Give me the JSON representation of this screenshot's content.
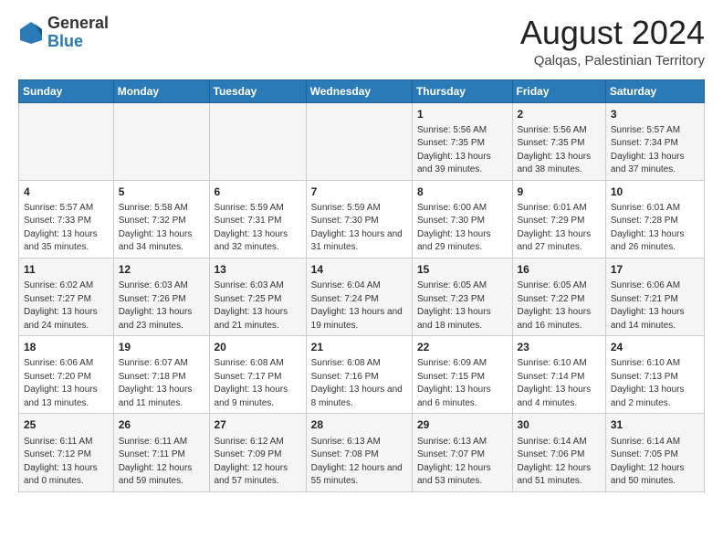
{
  "logo": {
    "general": "General",
    "blue": "Blue"
  },
  "header": {
    "month_year": "August 2024",
    "location": "Qalqas, Palestinian Territory"
  },
  "weekdays": [
    "Sunday",
    "Monday",
    "Tuesday",
    "Wednesday",
    "Thursday",
    "Friday",
    "Saturday"
  ],
  "weeks": [
    [
      {
        "day": "",
        "info": ""
      },
      {
        "day": "",
        "info": ""
      },
      {
        "day": "",
        "info": ""
      },
      {
        "day": "",
        "info": ""
      },
      {
        "day": "1",
        "info": "Sunrise: 5:56 AM\nSunset: 7:35 PM\nDaylight: 13 hours and 39 minutes."
      },
      {
        "day": "2",
        "info": "Sunrise: 5:56 AM\nSunset: 7:35 PM\nDaylight: 13 hours and 38 minutes."
      },
      {
        "day": "3",
        "info": "Sunrise: 5:57 AM\nSunset: 7:34 PM\nDaylight: 13 hours and 37 minutes."
      }
    ],
    [
      {
        "day": "4",
        "info": "Sunrise: 5:57 AM\nSunset: 7:33 PM\nDaylight: 13 hours and 35 minutes."
      },
      {
        "day": "5",
        "info": "Sunrise: 5:58 AM\nSunset: 7:32 PM\nDaylight: 13 hours and 34 minutes."
      },
      {
        "day": "6",
        "info": "Sunrise: 5:59 AM\nSunset: 7:31 PM\nDaylight: 13 hours and 32 minutes."
      },
      {
        "day": "7",
        "info": "Sunrise: 5:59 AM\nSunset: 7:30 PM\nDaylight: 13 hours and 31 minutes."
      },
      {
        "day": "8",
        "info": "Sunrise: 6:00 AM\nSunset: 7:30 PM\nDaylight: 13 hours and 29 minutes."
      },
      {
        "day": "9",
        "info": "Sunrise: 6:01 AM\nSunset: 7:29 PM\nDaylight: 13 hours and 27 minutes."
      },
      {
        "day": "10",
        "info": "Sunrise: 6:01 AM\nSunset: 7:28 PM\nDaylight: 13 hours and 26 minutes."
      }
    ],
    [
      {
        "day": "11",
        "info": "Sunrise: 6:02 AM\nSunset: 7:27 PM\nDaylight: 13 hours and 24 minutes."
      },
      {
        "day": "12",
        "info": "Sunrise: 6:03 AM\nSunset: 7:26 PM\nDaylight: 13 hours and 23 minutes."
      },
      {
        "day": "13",
        "info": "Sunrise: 6:03 AM\nSunset: 7:25 PM\nDaylight: 13 hours and 21 minutes."
      },
      {
        "day": "14",
        "info": "Sunrise: 6:04 AM\nSunset: 7:24 PM\nDaylight: 13 hours and 19 minutes."
      },
      {
        "day": "15",
        "info": "Sunrise: 6:05 AM\nSunset: 7:23 PM\nDaylight: 13 hours and 18 minutes."
      },
      {
        "day": "16",
        "info": "Sunrise: 6:05 AM\nSunset: 7:22 PM\nDaylight: 13 hours and 16 minutes."
      },
      {
        "day": "17",
        "info": "Sunrise: 6:06 AM\nSunset: 7:21 PM\nDaylight: 13 hours and 14 minutes."
      }
    ],
    [
      {
        "day": "18",
        "info": "Sunrise: 6:06 AM\nSunset: 7:20 PM\nDaylight: 13 hours and 13 minutes."
      },
      {
        "day": "19",
        "info": "Sunrise: 6:07 AM\nSunset: 7:18 PM\nDaylight: 13 hours and 11 minutes."
      },
      {
        "day": "20",
        "info": "Sunrise: 6:08 AM\nSunset: 7:17 PM\nDaylight: 13 hours and 9 minutes."
      },
      {
        "day": "21",
        "info": "Sunrise: 6:08 AM\nSunset: 7:16 PM\nDaylight: 13 hours and 8 minutes."
      },
      {
        "day": "22",
        "info": "Sunrise: 6:09 AM\nSunset: 7:15 PM\nDaylight: 13 hours and 6 minutes."
      },
      {
        "day": "23",
        "info": "Sunrise: 6:10 AM\nSunset: 7:14 PM\nDaylight: 13 hours and 4 minutes."
      },
      {
        "day": "24",
        "info": "Sunrise: 6:10 AM\nSunset: 7:13 PM\nDaylight: 13 hours and 2 minutes."
      }
    ],
    [
      {
        "day": "25",
        "info": "Sunrise: 6:11 AM\nSunset: 7:12 PM\nDaylight: 13 hours and 0 minutes."
      },
      {
        "day": "26",
        "info": "Sunrise: 6:11 AM\nSunset: 7:11 PM\nDaylight: 12 hours and 59 minutes."
      },
      {
        "day": "27",
        "info": "Sunrise: 6:12 AM\nSunset: 7:09 PM\nDaylight: 12 hours and 57 minutes."
      },
      {
        "day": "28",
        "info": "Sunrise: 6:13 AM\nSunset: 7:08 PM\nDaylight: 12 hours and 55 minutes."
      },
      {
        "day": "29",
        "info": "Sunrise: 6:13 AM\nSunset: 7:07 PM\nDaylight: 12 hours and 53 minutes."
      },
      {
        "day": "30",
        "info": "Sunrise: 6:14 AM\nSunset: 7:06 PM\nDaylight: 12 hours and 51 minutes."
      },
      {
        "day": "31",
        "info": "Sunrise: 6:14 AM\nSunset: 7:05 PM\nDaylight: 12 hours and 50 minutes."
      }
    ]
  ]
}
